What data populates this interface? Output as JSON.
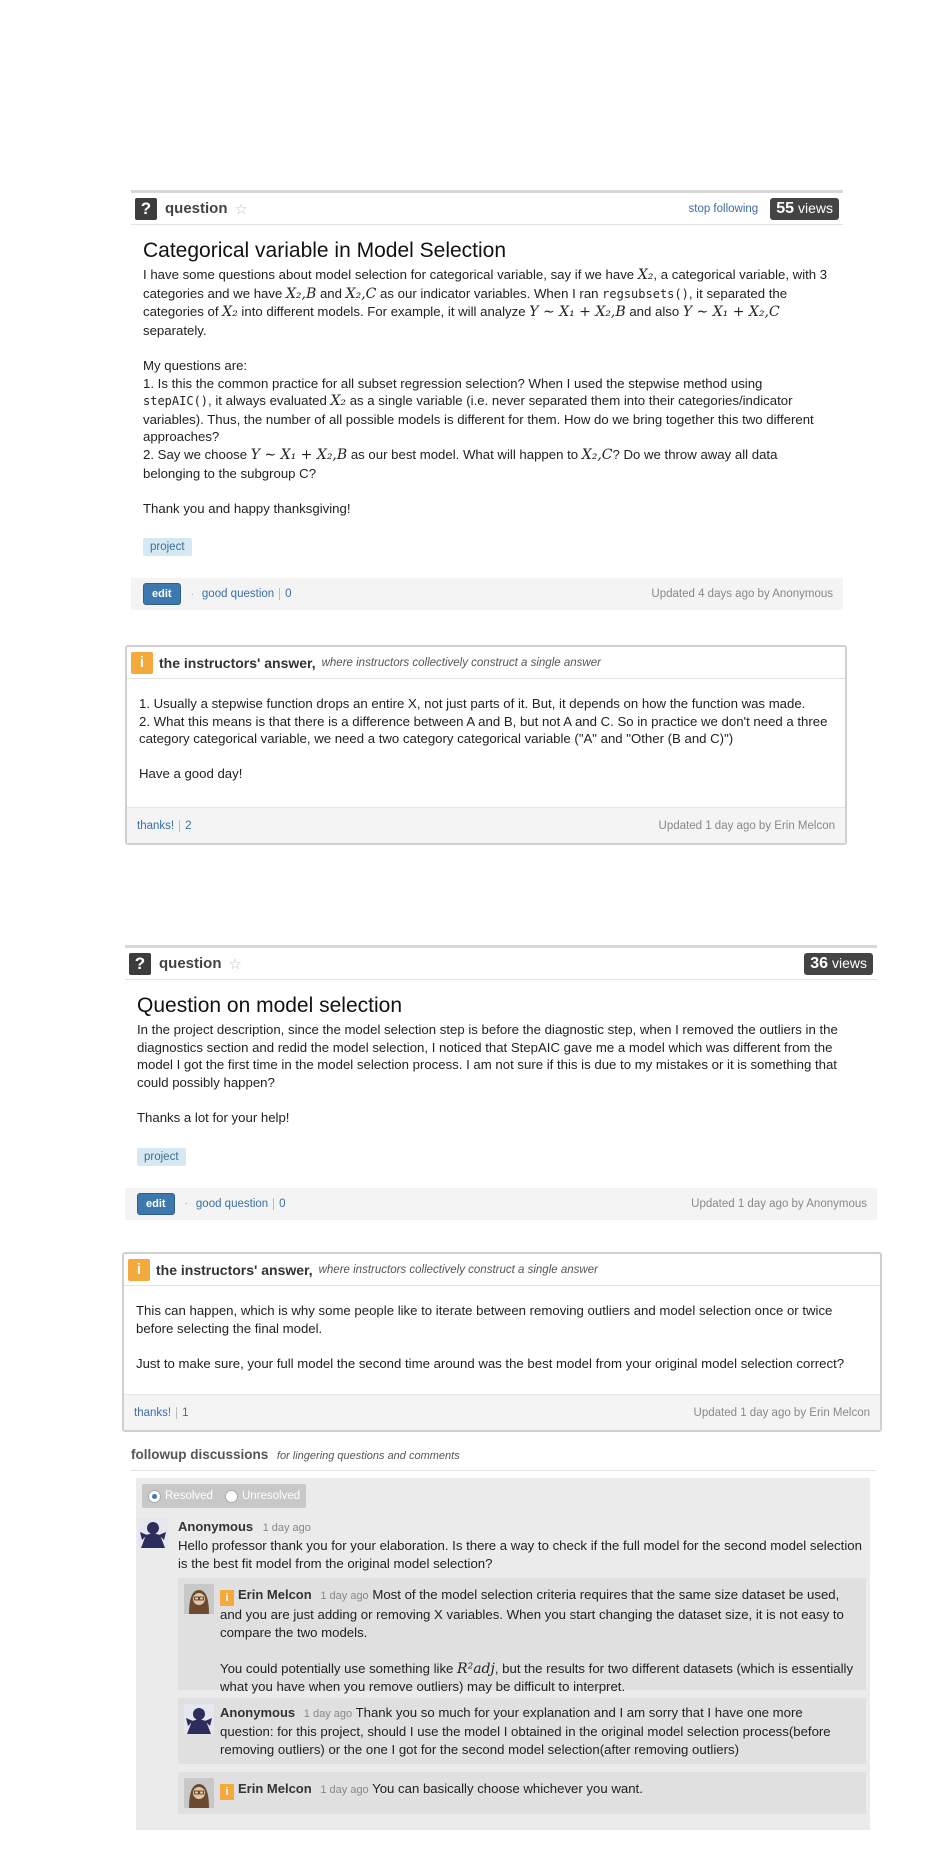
{
  "post1": {
    "question_label": "question",
    "stop_following": "stop following",
    "views_count": "55",
    "views_label": "views",
    "title": "Categorical variable in Model Selection",
    "body": {
      "p1_a": "I have some questions about model selection for categorical variable, say if we have ",
      "math_x2": "X₂",
      "p1_b": ", a categorical variable, with 3 categories and we have ",
      "math_x2b": "X₂,B",
      "p1_c": " and ",
      "math_x2c": "X₂,C",
      "p1_d": " as our indicator variables. When I ran ",
      "code_regsubsets": "regsubsets()",
      "p1_e": ", it separated the categories of ",
      "p1_f": " into different models. For example, it will analyze ",
      "math_model_b": "Y ∼ X₁ + X₂,B",
      "p1_g": " and also ",
      "math_model_c": "Y ∼ X₁ + X₂,C",
      "p1_h": " separately.",
      "p2": "My questions are:",
      "p3_a": "1. Is this the common practice for all subset regression selection? When I used the stepwise method using ",
      "code_stepaic": "stepAIC()",
      "p3_b": ", it always evaluated ",
      "p3_c": " as a single variable (i.e. never separated them into their categories/indicator variables). Thus, the number of all possible models is different for them. How do we bring together this two different approaches?",
      "p4_a": "2. Say we choose ",
      "p4_b": " as our best model. What will happen to ",
      "p4_c": "? Do we throw away all data belonging to the subgroup C?",
      "p5": "Thank you and happy thanksgiving!"
    },
    "tag": "project",
    "edit_label": "edit",
    "good_question_label": "good question",
    "good_question_count": "0",
    "updated": "Updated 4 days ago by Anonymous"
  },
  "answer1": {
    "title": "the instructors' answer,",
    "subtitle": "where instructors collectively construct a single answer",
    "p1": "1. Usually a stepwise function drops an entire X, not just parts of it.  But, it depends on how the function was made.",
    "p2": "2. What this means is that there is a difference between A and B, but not A and C.  So in practice we don't need a three category categorical variable, we need a two category categorical variable (\"A\" and \"Other (B and C)\")",
    "p3": "Have a good day!",
    "thanks_label": "thanks!",
    "thanks_count": "2",
    "updated": "Updated 1 day ago by Erin Melcon"
  },
  "post2": {
    "question_label": "question",
    "views_count": "36",
    "views_label": "views",
    "title": "Question on model selection",
    "p1": "In the project description, since the model selection step is before the diagnostic step, when I removed the outliers in the diagnostics section and redid the model selection, I noticed that  StepAIC gave me a model which was different from the model I got the first time in the model selection process. I am not sure if this is due to my mistakes or it is something that could possibly happen?",
    "p2": "Thanks a lot for your help!",
    "tag": "project",
    "edit_label": "edit",
    "good_question_label": "good question",
    "good_question_count": "0",
    "updated": "Updated 1 day ago by Anonymous"
  },
  "answer2": {
    "title": "the instructors' answer,",
    "subtitle": "where instructors collectively construct a single answer",
    "p1": "This can happen, which is why some people like to iterate between removing outliers and model selection once or twice before selecting the final model.",
    "p2": "Just to make sure, your full model the second time around was the best model from your original model selection correct?",
    "thanks_label": "thanks!",
    "thanks_count": "1",
    "updated": "Updated 1 day ago by Erin Melcon"
  },
  "followup": {
    "title": "followup discussions",
    "subtitle": "for lingering questions and comments",
    "resolved_label": "Resolved",
    "unresolved_label": "Unresolved",
    "comment1": {
      "author": "Anonymous",
      "time": "1 day ago",
      "text": "Hello professor thank you for your elaboration. Is there a way to check if the full model for the second model selection is the best fit model from the original model selection?"
    },
    "reply1": {
      "author": "Erin Melcon",
      "time": "1 day ago",
      "text1": "Most of the model selection criteria requires that the same size dataset be used, and you are just adding or removing X variables.  When you start changing the dataset size, it is not easy to compare the two models.",
      "text2_a": "You could potentially use something like ",
      "math_r2": "R²adj",
      "text2_b": ", but the results for two different datasets (which is essentially what you have when you remove outliers) may be difficult to interpret."
    },
    "reply2": {
      "author": "Anonymous",
      "time": "1 day ago",
      "text": "Thank you so much for your explanation and I am sorry that I have one more question: for this project, should I use the model I obtained in the original model selection process(before removing outliers) or the one I got for the second model selection(after removing outliers)"
    },
    "reply3": {
      "author": "Erin Melcon",
      "time": "1 day ago",
      "text": "You can basically choose whichever you want."
    }
  },
  "colors": {
    "link": "#3a6ea5",
    "instructor_badge": "#f3a93c",
    "edit_button": "#3d78ae",
    "views_badge": "#444444"
  },
  "icons": [
    "question-icon",
    "star-icon",
    "instructor-icon",
    "radio-icon",
    "avatar-anonymous",
    "avatar-instructor"
  ]
}
